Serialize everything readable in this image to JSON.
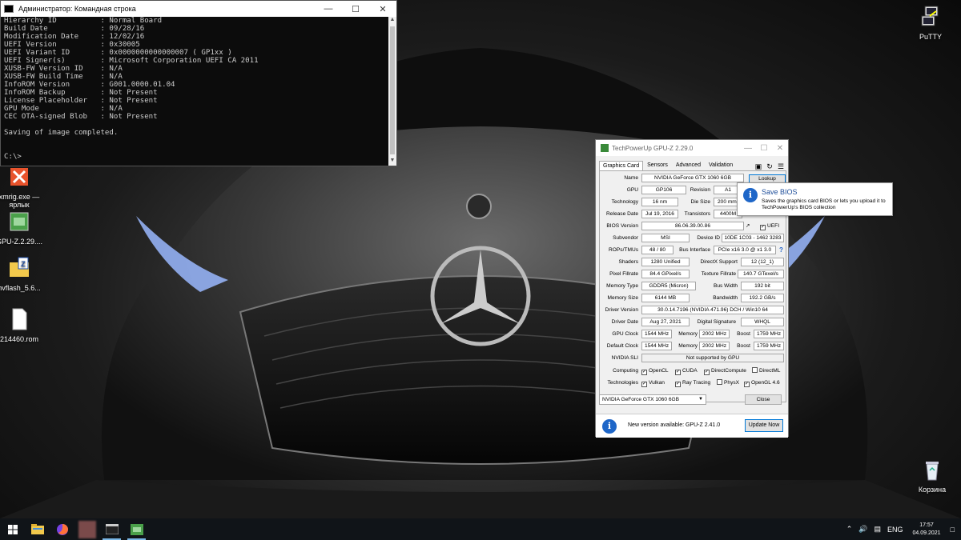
{
  "cmd": {
    "title": "Администратор: Командная строка",
    "lines": [
      "Hierarchy ID          : Normal Board",
      "Build Date            : 09/28/16",
      "Modification Date     : 12/02/16",
      "UEFI Version          : 0x30005",
      "UEFI Variant ID       : 0x0000000000000007 ( GP1xx )",
      "UEFI Signer(s)        : Microsoft Corporation UEFI CA 2011",
      "XUSB-FW Version ID    : N/A",
      "XUSB-FW Build Time    : N/A",
      "InfoROM Version       : G001.0000.01.04",
      "InfoROM Backup        : Not Present",
      "License Placeholder   : Not Present",
      "GPU Mode              : N/A",
      "CEC OTA-signed Blob   : Not Present",
      "",
      "Saving of image completed.",
      "",
      "",
      "C:\\>"
    ]
  },
  "desktop": {
    "icons": [
      {
        "label": "PuTTY"
      },
      {
        "label": "xmrig.exe — ярлык"
      },
      {
        "label": "GPU-Z.2.29...."
      },
      {
        "label": "nvflash_5.6..."
      },
      {
        "label": "214460.rom"
      },
      {
        "label": "Корзина"
      }
    ]
  },
  "gpuz": {
    "title": "TechPowerUp GPU-Z 2.29.0",
    "tabs": [
      "Graphics Card",
      "Sensors",
      "Advanced",
      "Validation"
    ],
    "labels": {
      "name": "Name",
      "gpu": "GPU",
      "revision": "Revision",
      "technology": "Technology",
      "die_size": "Die Size",
      "release_date": "Release Date",
      "transistors": "Transistors",
      "bios_version": "BIOS Version",
      "subvendor": "Subvendor",
      "device_id": "Device ID",
      "rops_tmus": "ROPs/TMUs",
      "bus_interface": "Bus Interface",
      "shaders": "Shaders",
      "directx_support": "DirectX Support",
      "pixel_fillrate": "Pixel Fillrate",
      "texture_fillrate": "Texture Fillrate",
      "memory_type": "Memory Type",
      "bus_width": "Bus Width",
      "memory_size": "Memory Size",
      "bandwidth": "Bandwidth",
      "driver_version": "Driver Version",
      "driver_date": "Driver Date",
      "digital_signature": "Digital Signature",
      "gpu_clock": "GPU Clock",
      "memory": "Memory",
      "boost": "Boost",
      "default_clock": "Default Clock",
      "nvidia_sli": "NVIDIA SLI",
      "computing": "Computing",
      "technologies": "Technologies"
    },
    "values": {
      "name": "NVIDIA GeForce GTX 1060 6GB",
      "gpu": "GP106",
      "revision": "A1",
      "technology": "16 nm",
      "die_size": "200 mm²",
      "release_date": "Jul 19, 2016",
      "transistors": "4400M",
      "bios_version": "86.06.39.00.86",
      "uefi": "UEFI",
      "subvendor": "MSI",
      "device_id": "10DE 1C03 - 1462 3283",
      "rops_tmus": "48 / 80",
      "bus_interface": "PCIe x16 3.0 @ x1 3.0",
      "shaders": "1280 Unified",
      "directx_support": "12 (12_1)",
      "pixel_fillrate": "84.4 GPixel/s",
      "texture_fillrate": "140.7 GTexel/s",
      "memory_type": "GDDR5 (Micron)",
      "bus_width": "192 bit",
      "memory_size": "6144 MB",
      "bandwidth": "192.2 GB/s",
      "driver_version": "30.0.14.7196 (NVIDIA 471.96) DCH / Win10 64",
      "driver_date": "Aug 27, 2021",
      "digital_signature": "WHQL",
      "gpu_clock": "1544 MHz",
      "gpu_memory": "2002 MHz",
      "gpu_boost": "1759 MHz",
      "default_clock": "1544 MHz",
      "default_memory": "2002 MHz",
      "default_boost": "1759 MHz",
      "nvidia_sli": "Not supported by GPU"
    },
    "computing": [
      {
        "label": "OpenCL",
        "checked": true
      },
      {
        "label": "CUDA",
        "checked": true
      },
      {
        "label": "DirectCompute",
        "checked": true
      },
      {
        "label": "DirectML",
        "checked": false
      }
    ],
    "technologies": [
      {
        "label": "Vulkan",
        "checked": true
      },
      {
        "label": "Ray Tracing",
        "checked": true
      },
      {
        "label": "PhysX",
        "checked": false
      },
      {
        "label": "OpenGL 4.6",
        "checked": true
      }
    ],
    "lookup_label": "Lookup",
    "help": "?",
    "selected_gpu": "NVIDIA GeForce GTX 1060 6GB",
    "close_label": "Close",
    "update_text": "New version available: GPU-Z 2.41.0",
    "update_button": "Update Now"
  },
  "tooltip": {
    "title": "Save BIOS",
    "body": "Saves the graphics card BIOS or lets you upload it to TechPowerUp's BIOS collection"
  },
  "taskbar": {
    "language": "ENG",
    "time": "17:57",
    "date": "04.09.2021"
  },
  "colors": {
    "accent": "#0078d7",
    "info_blue": "#1e66c8",
    "taskbar": "#101418"
  }
}
